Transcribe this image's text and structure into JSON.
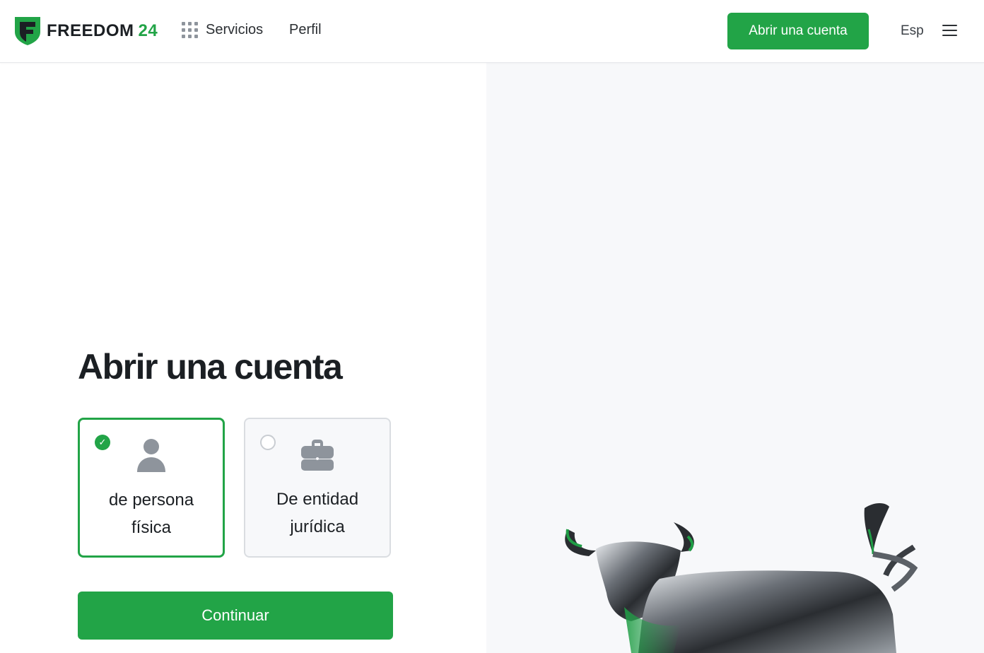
{
  "header": {
    "logo_text": "FREEDOM",
    "logo_number": "24",
    "logo_icon": "shield-logo-icon",
    "services_label": "Servicios",
    "services_icon": "grid-icon",
    "profile_label": "Perfil",
    "open_account_label": "Abrir una cuenta",
    "language_label": "Esp",
    "menu_icon": "hamburger-menu-icon"
  },
  "main": {
    "title": "Abrir una cuenta",
    "options": [
      {
        "label": "de persona física",
        "icon": "person-icon",
        "selected": true
      },
      {
        "label": "De entidad jurídica",
        "icon": "briefcase-icon",
        "selected": false
      }
    ],
    "continue_label": "Continuar"
  },
  "colors": {
    "brand_green": "#22a447",
    "dark_text": "#1b1f23",
    "panel_bg": "#f7f8fa"
  }
}
